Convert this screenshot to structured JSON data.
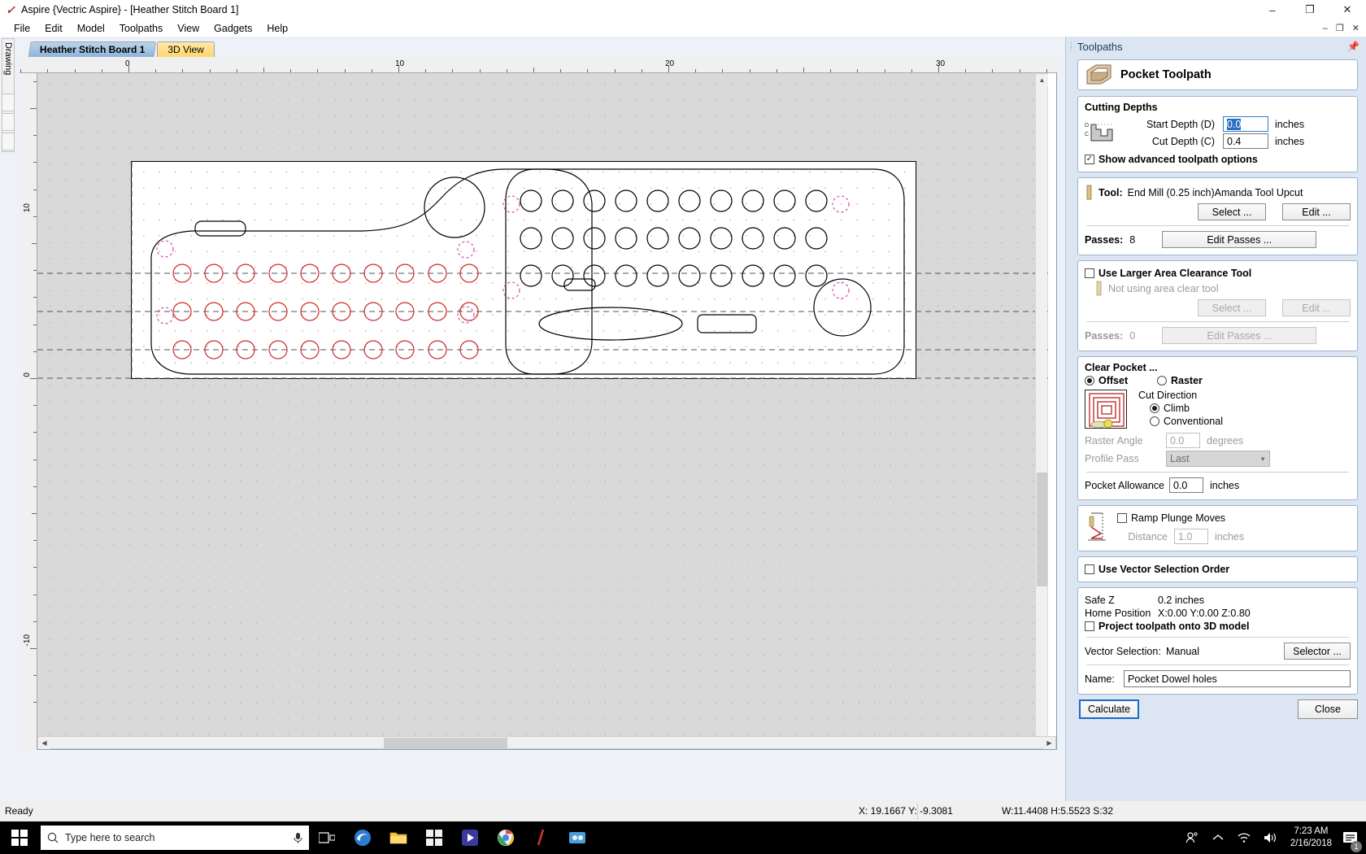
{
  "window": {
    "title": "Aspire {Vectric Aspire} - [Heather Stitch Board 1]",
    "app_icon": "aspire-logo-icon",
    "minimize": "–",
    "maximize": "❐",
    "close": "✕",
    "mdi_minimize": "–",
    "mdi_restore": "❐",
    "mdi_close": "✕"
  },
  "menu": {
    "items": [
      {
        "label": "File"
      },
      {
        "label": "Edit"
      },
      {
        "label": "Model"
      },
      {
        "label": "Toolpaths"
      },
      {
        "label": "View"
      },
      {
        "label": "Gadgets"
      },
      {
        "label": "Help"
      }
    ]
  },
  "left_dock": {
    "label": "Drawing"
  },
  "doc_tabs": [
    {
      "label": "Heather Stitch Board 1",
      "active": true
    },
    {
      "label": "3D View",
      "active": false
    }
  ],
  "rulers": {
    "horizontal_labels": [
      "0",
      "10",
      "20",
      "30"
    ],
    "vertical_labels": [
      "10",
      "0",
      "-10"
    ]
  },
  "toolpaths_panel": {
    "title": "Toolpaths",
    "pin_icon": "pin-icon",
    "header": {
      "icon": "pocket-toolpath-icon",
      "title": "Pocket Toolpath"
    },
    "cutting_depths": {
      "title": "Cutting Depths",
      "diagram_icon": "depth-profile-icon",
      "start_depth_label": "Start Depth (D)",
      "start_depth_value": "0.0",
      "start_depth_units": "inches",
      "cut_depth_label": "Cut Depth (C)",
      "cut_depth_value": "0.4",
      "cut_depth_units": "inches",
      "show_advanced_label": "Show advanced toolpath options",
      "show_advanced_checked": true
    },
    "tool": {
      "icon": "end-mill-icon",
      "label": "Tool:",
      "name": "End Mill (0.25 inch)Amanda Tool Upcut",
      "select_button": "Select ...",
      "edit_button": "Edit ...",
      "passes_label": "Passes:",
      "passes_value": "8",
      "edit_passes_button": "Edit Passes ..."
    },
    "area_clearance": {
      "checkbox_label": "Use Larger Area Clearance Tool",
      "checked": false,
      "icon": "end-mill-icon",
      "status": "Not using area clear tool",
      "select_button": "Select ...",
      "edit_button": "Edit ...",
      "passes_label": "Passes:",
      "passes_value": "0",
      "edit_passes_button": "Edit Passes ..."
    },
    "clear_pocket": {
      "title": "Clear Pocket ...",
      "offset_label": "Offset",
      "raster_label": "Raster",
      "strategy_selected": "Offset",
      "preview_icon": "offset-pocket-preview-icon",
      "cut_direction_label": "Cut Direction",
      "climb_label": "Climb",
      "conventional_label": "Conventional",
      "direction_selected": "Climb",
      "raster_angle_label": "Raster Angle",
      "raster_angle_value": "0.0",
      "raster_angle_units": "degrees",
      "profile_pass_label": "Profile Pass",
      "profile_pass_value": "Last",
      "pocket_allowance_label": "Pocket Allowance",
      "pocket_allowance_value": "0.0",
      "pocket_allowance_units": "inches"
    },
    "ramp": {
      "icon": "ramp-plunge-icon",
      "checkbox_label": "Ramp Plunge Moves",
      "checked": false,
      "distance_label": "Distance",
      "distance_value": "1.0",
      "distance_units": "inches"
    },
    "vector_order": {
      "checkbox_label": "Use Vector Selection Order",
      "checked": false
    },
    "position": {
      "safe_z_label": "Safe Z",
      "safe_z_value": "0.2 inches",
      "home_position_label": "Home Position",
      "home_position_value": "X:0.00 Y:0.00 Z:0.80",
      "project_label": "Project toolpath onto 3D model",
      "project_checked": false,
      "vector_selection_label": "Vector Selection:",
      "vector_selection_value": "Manual",
      "selector_button": "Selector ..."
    },
    "name": {
      "label": "Name:",
      "value": "Pocket Dowel holes"
    },
    "actions": {
      "calculate": "Calculate",
      "close": "Close"
    }
  },
  "statusbar": {
    "ready": "Ready",
    "coords": "X: 19.1667 Y: -9.3081",
    "dimensions": "W:11.4408  H:5.5523  S:32"
  },
  "taskbar": {
    "start_icon": "windows-start-icon",
    "search_icon": "search-circle-icon",
    "search_placeholder": "Type here to search",
    "mic_icon": "microphone-icon",
    "items": [
      {
        "name": "task-view-icon",
        "label": "▣"
      },
      {
        "name": "edge-browser-icon",
        "label": "e"
      },
      {
        "name": "file-explorer-icon",
        "label": "📁"
      },
      {
        "name": "microsoft-store-icon",
        "label": "⊞"
      },
      {
        "name": "media-player-icon",
        "label": "▶"
      },
      {
        "name": "chrome-browser-icon",
        "label": "●"
      },
      {
        "name": "aspire-app-icon",
        "label": "∕"
      },
      {
        "name": "vcarve-app-icon",
        "label": "◆"
      }
    ],
    "tray": {
      "people_icon": "people-icon",
      "chevron_icon": "show-hidden-icons-icon",
      "network_icon": "wifi-icon",
      "volume_icon": "speaker-icon",
      "time": "7:23 AM",
      "date": "2/16/2018",
      "notification_icon": "action-center-icon",
      "notification_count": "1"
    }
  }
}
